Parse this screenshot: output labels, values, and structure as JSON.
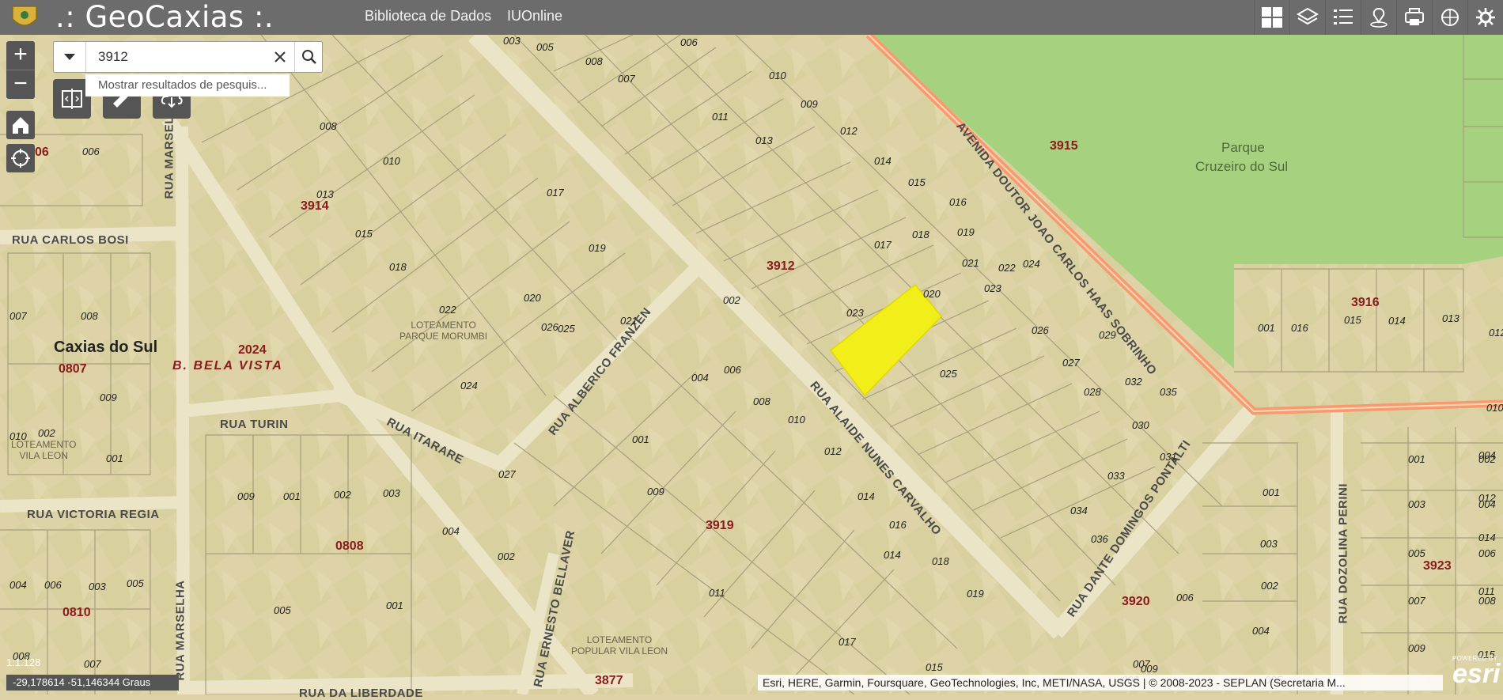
{
  "header": {
    "title": ".: GeoCaxias :.",
    "links": [
      "Biblioteca de Dados",
      "IUOnline"
    ],
    "tools": [
      "basemap-gallery-icon",
      "layers-icon",
      "legend-icon",
      "location-icon",
      "print-icon",
      "analysis-icon",
      "settings-icon"
    ]
  },
  "search": {
    "value": "3912",
    "suggestion": "Mostrar resultados de pesquis..."
  },
  "map": {
    "scale": "1:1.128",
    "coordinates": "-29,178614 -51,146344 Graus",
    "attribution": "Esri, HERE, Garmin, Foursquare, GeoTechnologies, Inc, METI/NASA, USGS | © 2008-2023 - SEPLAN (Secretaria M...",
    "powered_by": "POWERED BY",
    "brand": "esri",
    "highlight_color": "#f2ee1a",
    "park_color": "#a6d17f",
    "road_color": "#f79a6f",
    "park_name": [
      "Parque",
      "Cruzeiro do Sul"
    ],
    "city": "Caxias do Sul",
    "neighborhood": "B. BELA VISTA",
    "streets": [
      "RUA CARLOS BOSI",
      "RUA MARSELHA",
      "RUA TURIN",
      "RUA ITARARE",
      "RUA VICTORIA REGIA",
      "RUA MARSELHA",
      "RUA DA LIBERDADE",
      "RUA ERNESTO BELLAVER",
      "RUA ALBERICO FRANZEN",
      "RUA ALAIDE NUNES CARVALHO",
      "AVENIDA DOUTOR JOAO CARLOS HAAS SOBRINHO",
      "RUA DANTE DOMINGOS PONTALTI",
      "RUA DOZOLINA PERINI"
    ],
    "subdivisions": [
      [
        "LOTEAMENTO",
        "PARQUE MORUMBI"
      ],
      [
        "LOTEAMENTO",
        "VILA LEON"
      ],
      [
        "LOTEAMENTO",
        "POPULAR VILA LEON"
      ]
    ],
    "blocks": [
      "3912",
      "3914",
      "3915",
      "3916",
      "3919",
      "3920",
      "3923",
      "3877",
      "2024",
      "0807",
      "0808",
      "0810",
      "06"
    ],
    "lots": [
      "003",
      "005",
      "006",
      "008",
      "010",
      "007",
      "009",
      "011",
      "012",
      "013",
      "014",
      "015",
      "016",
      "017",
      "018",
      "019",
      "020",
      "021",
      "022",
      "023",
      "024",
      "025",
      "026",
      "027",
      "028",
      "029",
      "030",
      "031",
      "032",
      "033",
      "034",
      "035",
      "036",
      "008",
      "010",
      "013",
      "015",
      "017",
      "018",
      "019",
      "020",
      "021",
      "022",
      "023",
      "024",
      "025",
      "026",
      "027",
      "002",
      "004",
      "006",
      "008",
      "010",
      "012",
      "014",
      "016",
      "018",
      "019",
      "011",
      "009",
      "001",
      "017",
      "014",
      "015",
      "001",
      "016",
      "015",
      "014",
      "013",
      "012",
      "010",
      "001",
      "002",
      "003",
      "004",
      "005",
      "006",
      "007",
      "008",
      "009",
      "001",
      "003",
      "002",
      "004",
      "005",
      "006",
      "007",
      "008",
      "009",
      "015",
      "011",
      "014",
      "012",
      "004",
      "006",
      "007",
      "008",
      "009",
      "010",
      "002",
      "001",
      "006",
      "004",
      "003",
      "005",
      "008",
      "007",
      "009",
      "001",
      "002",
      "003",
      "004",
      "005",
      "001",
      "002"
    ]
  }
}
